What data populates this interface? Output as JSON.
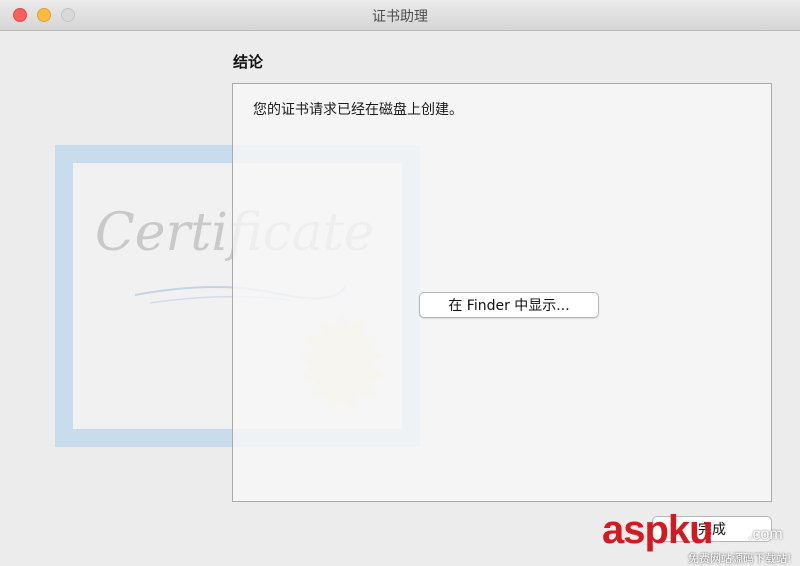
{
  "window": {
    "title": "证书助理",
    "controls": [
      "close",
      "minimize",
      "zoom"
    ]
  },
  "section": {
    "heading": "结论"
  },
  "content": {
    "message": "您的证书请求已经在磁盘上创建。",
    "show_in_finder_label": "在 Finder 中显示..."
  },
  "footer": {
    "done_label": "完成"
  },
  "watermark": {
    "brand": "aspku",
    "domain": ".com",
    "tagline": "免费网站源码下载站!"
  },
  "artwork": {
    "certificate_text": "Certificate",
    "colors": {
      "frame": "#c9dced",
      "seal": "#f3efd4"
    }
  }
}
